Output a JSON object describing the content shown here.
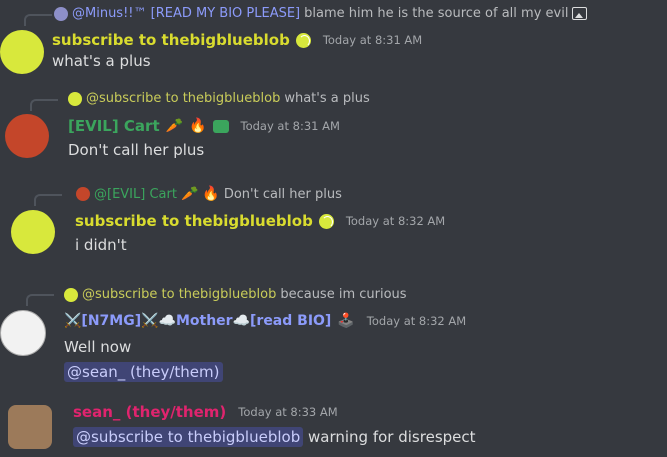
{
  "messages": [
    {
      "reply": {
        "author": "@Minus!!™ [READ MY BIO PLEASE]",
        "text": "blame him he is the source of all my evil"
      },
      "username": "subscribe to thebigblueblob",
      "timestamp": "Today at 8:31 AM",
      "text": "what's a plus"
    },
    {
      "reply": {
        "author": "@subscribe to thebigblueblob",
        "text": "what's a plus"
      },
      "username": "[EVIL] Cart",
      "timestamp": "Today at 8:31 AM",
      "text": "Don't call her plus"
    },
    {
      "reply": {
        "author": "@[EVIL] Cart",
        "text": "Don't call her plus"
      },
      "username": "subscribe to thebigblueblob",
      "timestamp": "Today at 8:32 AM",
      "text": "i didn't"
    },
    {
      "reply": {
        "author": "@subscribe to thebigblueblob",
        "text": "because im curious"
      },
      "username": "⚔️[N7MG]⚔️☁️Mother☁️[read BIO]",
      "timestamp": "Today at 8:32 AM",
      "text": "Well now",
      "mention": "@sean_ (they/them)"
    },
    {
      "username": "sean_ (they/them)",
      "timestamp": "Today at 8:33 AM",
      "mention": "@subscribe to thebigblueblob",
      "text": "warning for disrespect"
    }
  ],
  "colors": {
    "background": "#36393f",
    "blob_name": "#d9dc2f",
    "cart_name": "#3ba55d",
    "mother_name": "#8c9bfa",
    "sean_name": "#e0246e"
  },
  "icons": {
    "tennis_badge": "tennis-ball-icon",
    "carrot": "🥕",
    "fire": "🔥",
    "image_attachment": "image-icon",
    "joystick": "🕹️"
  }
}
